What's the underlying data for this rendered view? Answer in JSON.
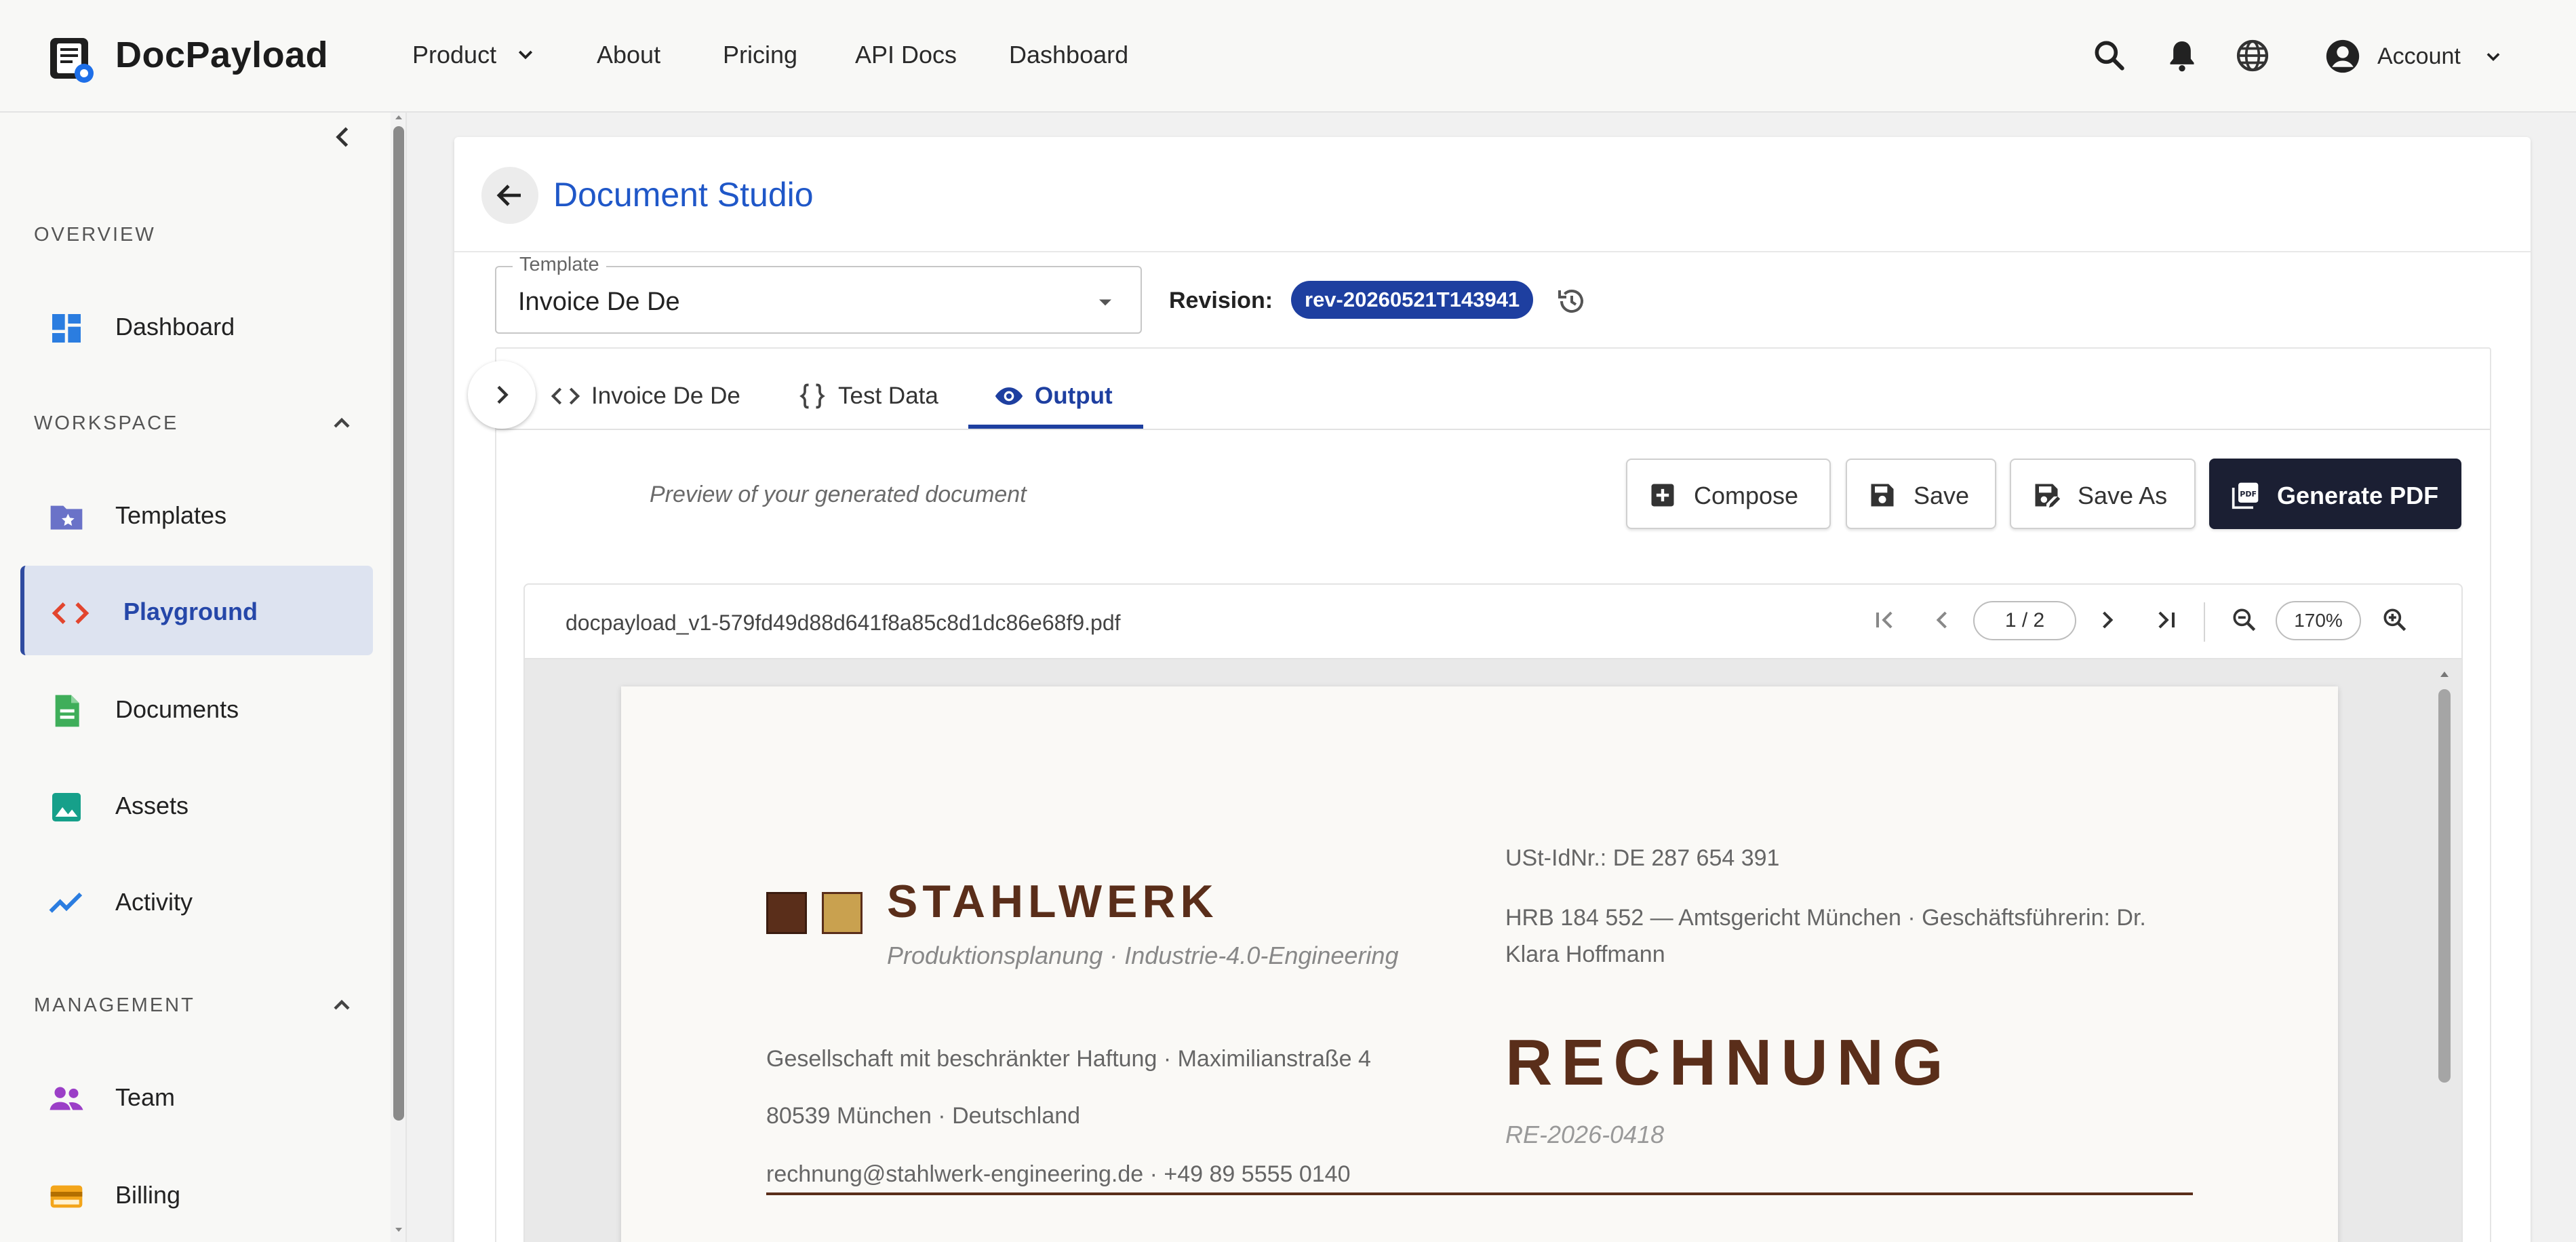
{
  "brand": {
    "name": "DocPayload"
  },
  "nav": {
    "product": "Product",
    "about": "About",
    "pricing": "Pricing",
    "api_docs": "API Docs",
    "dashboard": "Dashboard",
    "account": "Account"
  },
  "sidebar": {
    "sections": {
      "overview": "OVERVIEW",
      "workspace": "WORKSPACE",
      "management": "MANAGEMENT"
    },
    "items": {
      "dashboard": "Dashboard",
      "templates": "Templates",
      "playground": "Playground",
      "documents": "Documents",
      "assets": "Assets",
      "activity": "Activity",
      "team": "Team",
      "billing": "Billing"
    },
    "active_item": "Playground"
  },
  "studio": {
    "title": "Document Studio",
    "template_label": "Template",
    "template_value": "Invoice De De",
    "revision_label": "Revision:",
    "revision_value": "rev-20260521T143941"
  },
  "tabs": {
    "template": "Invoice De De",
    "test_data": "Test Data",
    "output": "Output",
    "active": "Output"
  },
  "actions": {
    "hint": "Preview of your generated document",
    "compose": "Compose",
    "save": "Save",
    "save_as": "Save As",
    "generate": "Generate PDF"
  },
  "viewer": {
    "filename": "docpayload_v1-579fd49d88d641f8a85c8d1dc86e68f9.pdf",
    "page_indicator": "1 / 2",
    "zoom": "170%"
  },
  "document": {
    "company_name": "STAHLWERK",
    "tagline": "Produktionsplanung · Industrie-4.0-Engineering",
    "vat_id": "USt-IdNr.: DE 287 654 391",
    "hrb": "HRB 184 552 — Amtsgericht München  ·  Geschäftsführerin: Dr. Klara Hoffmann",
    "legal": "Gesellschaft mit beschränkter Haftung  ·  Maximilianstraße 4",
    "address": "80539 München  ·  Deutschland",
    "contact": "rechnung@stahlwerk-engineering.de  ·  +49 89 5555 0140",
    "doc_title": "RECHNUNG",
    "invoice_number": "RE-2026-0418"
  },
  "colors": {
    "accent": "#1e3fa0",
    "link_blue": "#1f57c8",
    "brand_brown": "#5a2e1a",
    "brand_gold": "#c9a14f",
    "primary_button": "#1b1f33",
    "sidebar_active_bg": "#dde3f0"
  },
  "icons": {
    "search": "search-icon",
    "notifications": "bell-icon",
    "language": "globe-icon",
    "account": "account-circle-icon"
  }
}
